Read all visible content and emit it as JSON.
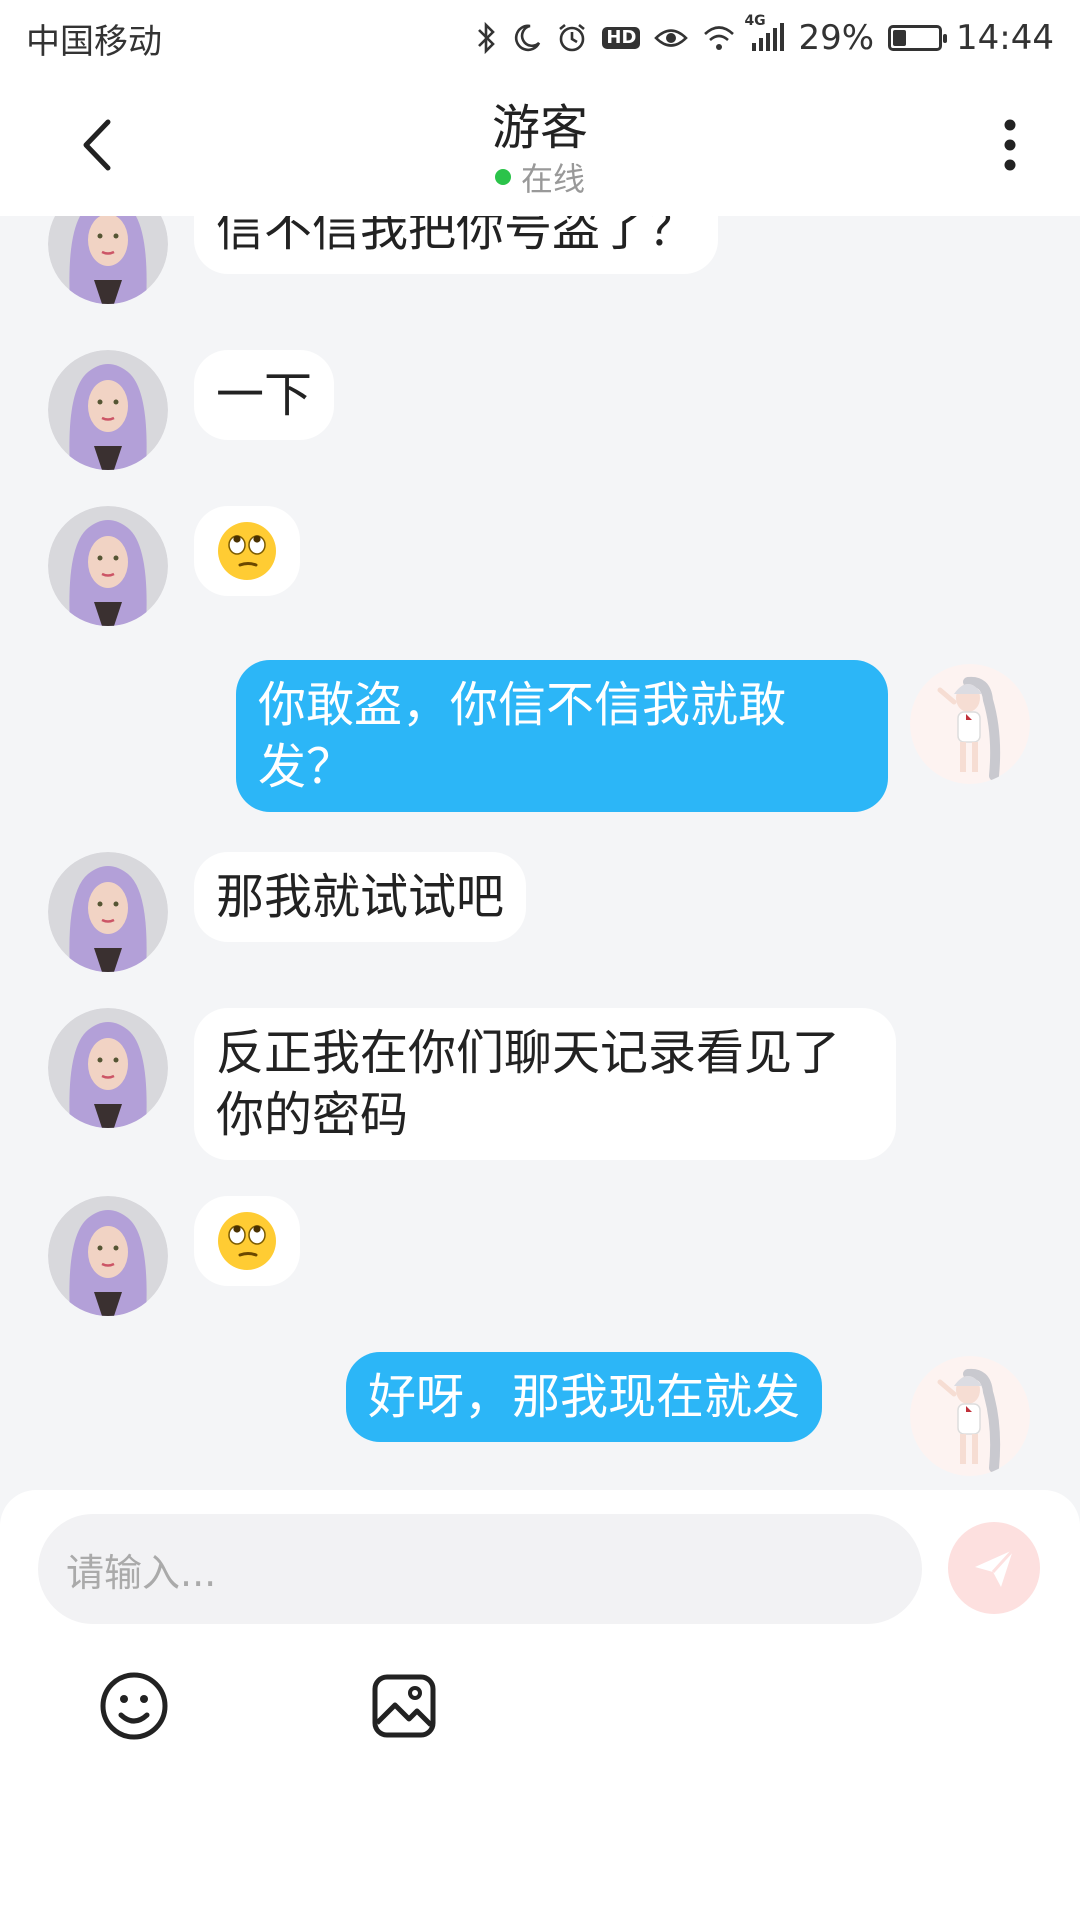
{
  "status_bar": {
    "carrier": "中国移动",
    "network": "4G",
    "battery": "29%",
    "battery_level": 0.29,
    "time": "14:44",
    "icons": [
      "bluetooth-icon",
      "moon-icon",
      "alarm-icon",
      "hd-icon",
      "eye-icon",
      "wifi-icon",
      "signal-icon",
      "battery-icon"
    ]
  },
  "header": {
    "title": "游客",
    "status": "在线",
    "status_color": "#2bc34a"
  },
  "messages": [
    {
      "side": "in",
      "text": "信不信我把你号盗了？"
    },
    {
      "side": "in",
      "text": "一下"
    },
    {
      "side": "in",
      "emoji": "eye-roll-emoji"
    },
    {
      "side": "out",
      "text": "你敢盗，你信不信我就敢发？"
    },
    {
      "side": "in",
      "text": "那我就试试吧"
    },
    {
      "side": "in",
      "text": "反正我在你们聊天记录看见了你的密码"
    },
    {
      "side": "in",
      "emoji": "eye-roll-emoji"
    },
    {
      "side": "out",
      "text": "好呀，那我现在就发"
    }
  ],
  "input": {
    "placeholder": "请输入..."
  },
  "colors": {
    "outgoing_bubble": "#2cb6f7",
    "incoming_bubble": "#ffffff",
    "send_button": "#fde0df",
    "background": "#f4f5f7"
  }
}
